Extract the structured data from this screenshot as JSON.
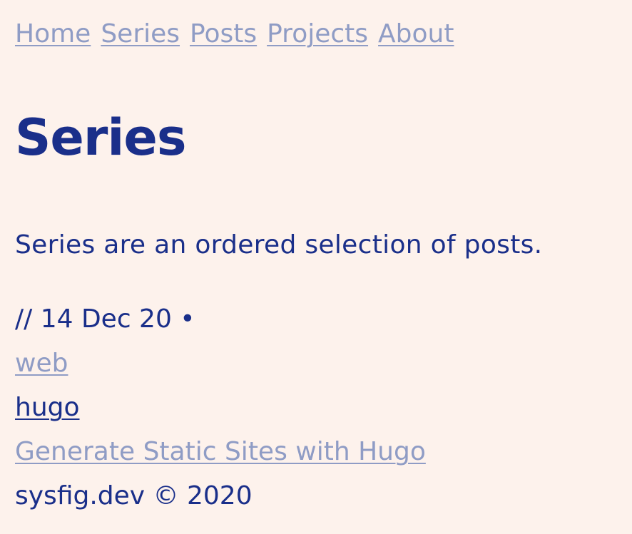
{
  "nav": {
    "items": [
      {
        "label": "Home"
      },
      {
        "label": "Series"
      },
      {
        "label": "Posts"
      },
      {
        "label": "Projects"
      },
      {
        "label": "About"
      }
    ]
  },
  "page": {
    "title": "Series",
    "intro": "Series are an ordered selection of posts."
  },
  "post": {
    "meta": "// 14 Dec 20 •",
    "tags": [
      "web",
      "hugo"
    ],
    "title": "Generate Static Sites with Hugo"
  },
  "footer": {
    "text": "sysfig.dev © 2020"
  },
  "colors": {
    "background": "#fdf2ec",
    "text": "#1a2f8a",
    "link": "#8f9cc5"
  }
}
